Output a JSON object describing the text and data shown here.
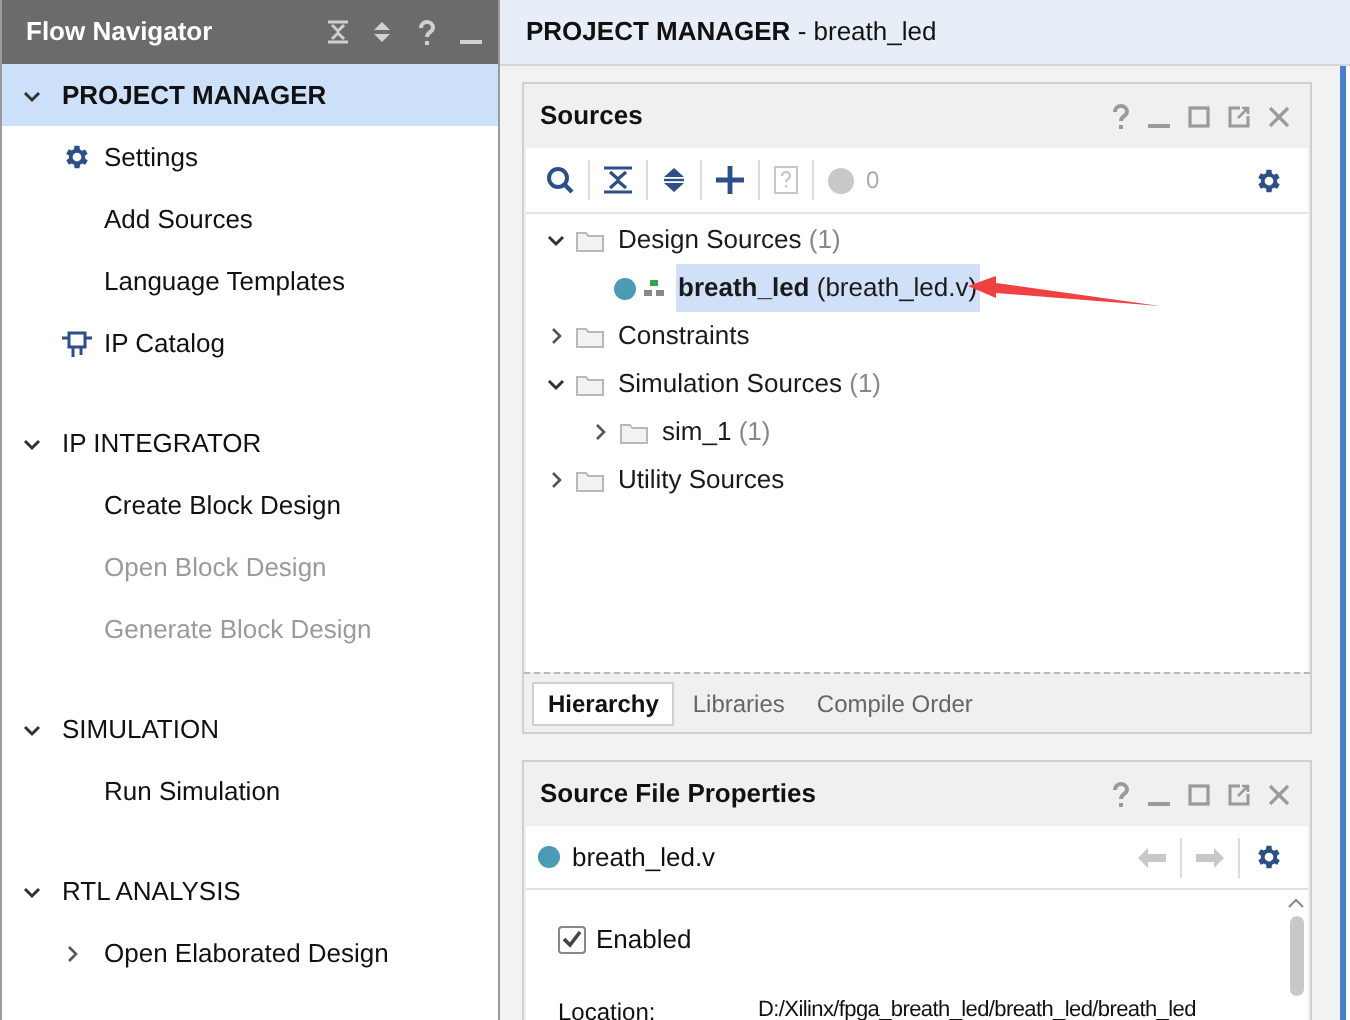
{
  "navigator": {
    "title": "Flow Navigator",
    "sections": [
      {
        "label": "PROJECT MANAGER",
        "selected": true,
        "expanded": true,
        "items": [
          {
            "label": "Settings",
            "kind": "gear",
            "disabled": false
          },
          {
            "label": "Add Sources",
            "kind": "plain",
            "disabled": false
          },
          {
            "label": "Language Templates",
            "kind": "plain",
            "disabled": false
          },
          {
            "label": "IP Catalog",
            "kind": "chip",
            "disabled": false
          }
        ]
      },
      {
        "label": "IP INTEGRATOR",
        "selected": false,
        "expanded": true,
        "items": [
          {
            "label": "Create Block Design",
            "kind": "plain",
            "disabled": false
          },
          {
            "label": "Open Block Design",
            "kind": "plain",
            "disabled": true
          },
          {
            "label": "Generate Block Design",
            "kind": "plain",
            "disabled": true
          }
        ]
      },
      {
        "label": "SIMULATION",
        "selected": false,
        "expanded": true,
        "items": [
          {
            "label": "Run Simulation",
            "kind": "plain",
            "disabled": false
          }
        ]
      },
      {
        "label": "RTL ANALYSIS",
        "selected": false,
        "expanded": true,
        "items": [
          {
            "label": "Open Elaborated Design",
            "kind": "expandable",
            "disabled": false
          }
        ]
      }
    ]
  },
  "header": {
    "title": "PROJECT MANAGER",
    "subtitle": "- breath_led"
  },
  "sources": {
    "title": "Sources",
    "message_count": "0",
    "tree": [
      {
        "label": "Design Sources",
        "count": "(1)",
        "expanded": true,
        "selected": false,
        "children": [
          {
            "label": "breath_led",
            "file": "(breath_led.v)",
            "selected": true
          }
        ]
      },
      {
        "label": "Constraints",
        "expanded": false,
        "selected": false
      },
      {
        "label": "Simulation Sources",
        "count": "(1)",
        "expanded": true,
        "selected": false,
        "children": [
          {
            "label": "sim_1",
            "count": "(1)",
            "expanded": false,
            "selected": false
          }
        ]
      },
      {
        "label": "Utility Sources",
        "expanded": false,
        "selected": false
      }
    ],
    "tabs": [
      {
        "label": "Hierarchy",
        "selected": true
      },
      {
        "label": "Libraries",
        "selected": false
      },
      {
        "label": "Compile Order",
        "selected": false
      }
    ]
  },
  "properties": {
    "title": "Source File Properties",
    "file": "breath_led.v",
    "enabled": {
      "label": "Enabled",
      "checked": true
    },
    "location": {
      "label": "Location:",
      "value": "D:/Xilinx/fpga_breath_led/breath_led/breath_led"
    }
  }
}
